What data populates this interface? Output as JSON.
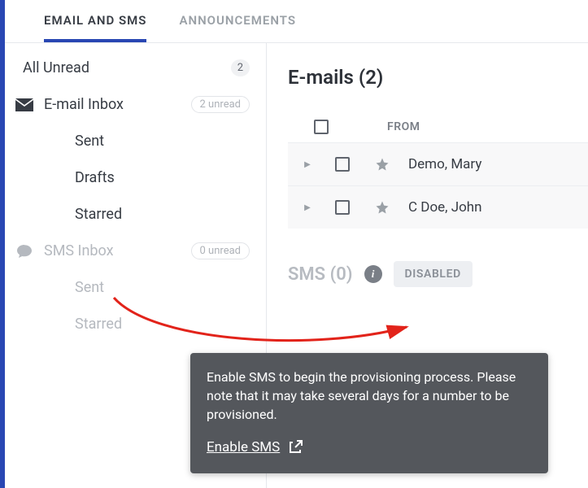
{
  "tabs": {
    "email_sms": "EMAIL AND SMS",
    "announcements": "ANNOUNCEMENTS"
  },
  "sidebar": {
    "all_unread": "All Unread",
    "all_unread_count": "2",
    "email_inbox": "E-mail Inbox",
    "email_inbox_badge": "2 unread",
    "sent": "Sent",
    "drafts": "Drafts",
    "starred": "Starred",
    "sms_inbox": "SMS Inbox",
    "sms_inbox_badge": "0 unread",
    "sms_sent": "Sent",
    "sms_starred": "Starred"
  },
  "main": {
    "emails_title": "E-mails (2)",
    "col_from": "FROM",
    "rows": [
      {
        "from": "Demo, Mary"
      },
      {
        "from": "C Doe, John"
      }
    ],
    "sms_title": "SMS (0)",
    "disabled_label": "DISABLED"
  },
  "tooltip": {
    "text": "Enable SMS to begin the provisioning process. Please note that it may take several days for a number to be provisioned.",
    "link": "Enable SMS"
  }
}
